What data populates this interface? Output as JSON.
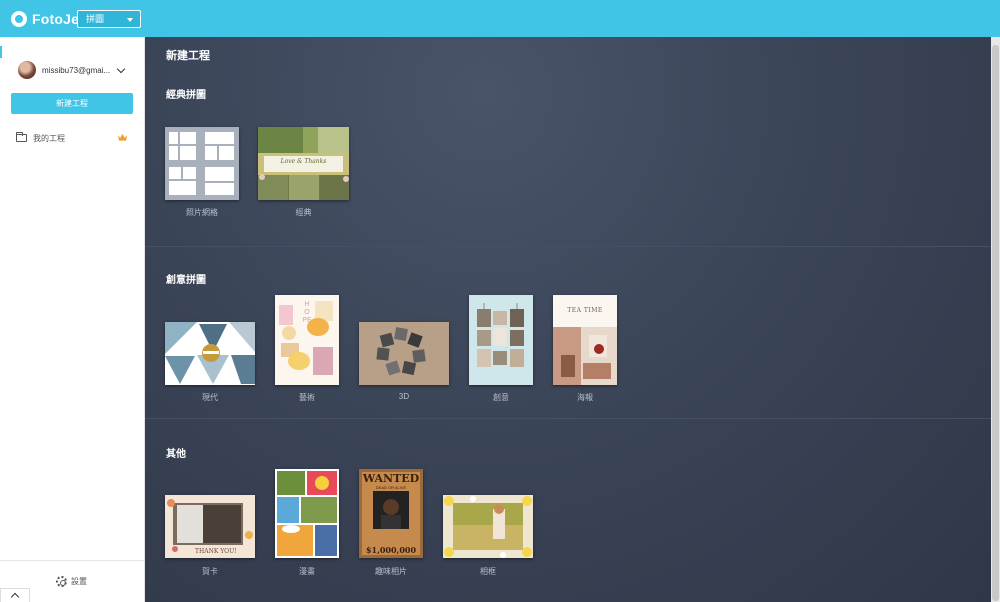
{
  "app": {
    "logo_text": "FotoJet",
    "mode_selected": "拼圖"
  },
  "sidebar": {
    "account_email": "missibu73@gmai...",
    "new_project_label": "新建工程",
    "my_projects_label": "我的工程",
    "settings_label": "設置"
  },
  "main": {
    "page_title": "新建工程",
    "sections": [
      {
        "title": "經典拼圖",
        "items": [
          "照片網格",
          "經典"
        ]
      },
      {
        "title": "創意拼圖",
        "items": [
          "現代",
          "藝術",
          "3D",
          "創意",
          "海報"
        ]
      },
      {
        "title": "其他",
        "items": [
          "賀卡",
          "漫畫",
          "趣味相片",
          "相框"
        ]
      }
    ]
  },
  "thumb_text": {
    "classic_banner": "Love & Thanks",
    "poster_heading": "TEA TIME",
    "art_letters": "HOPE",
    "wanted_title": "WANTED",
    "wanted_sub": "DEAD OR ALIVE",
    "wanted_reward": "$1,000,000",
    "card_text": "THANK YOU!"
  },
  "colors": {
    "topbar": "#40c5e6",
    "accent_button": "#40c5e6",
    "main_bg": "#3a4356",
    "crown": "#f0a030"
  }
}
